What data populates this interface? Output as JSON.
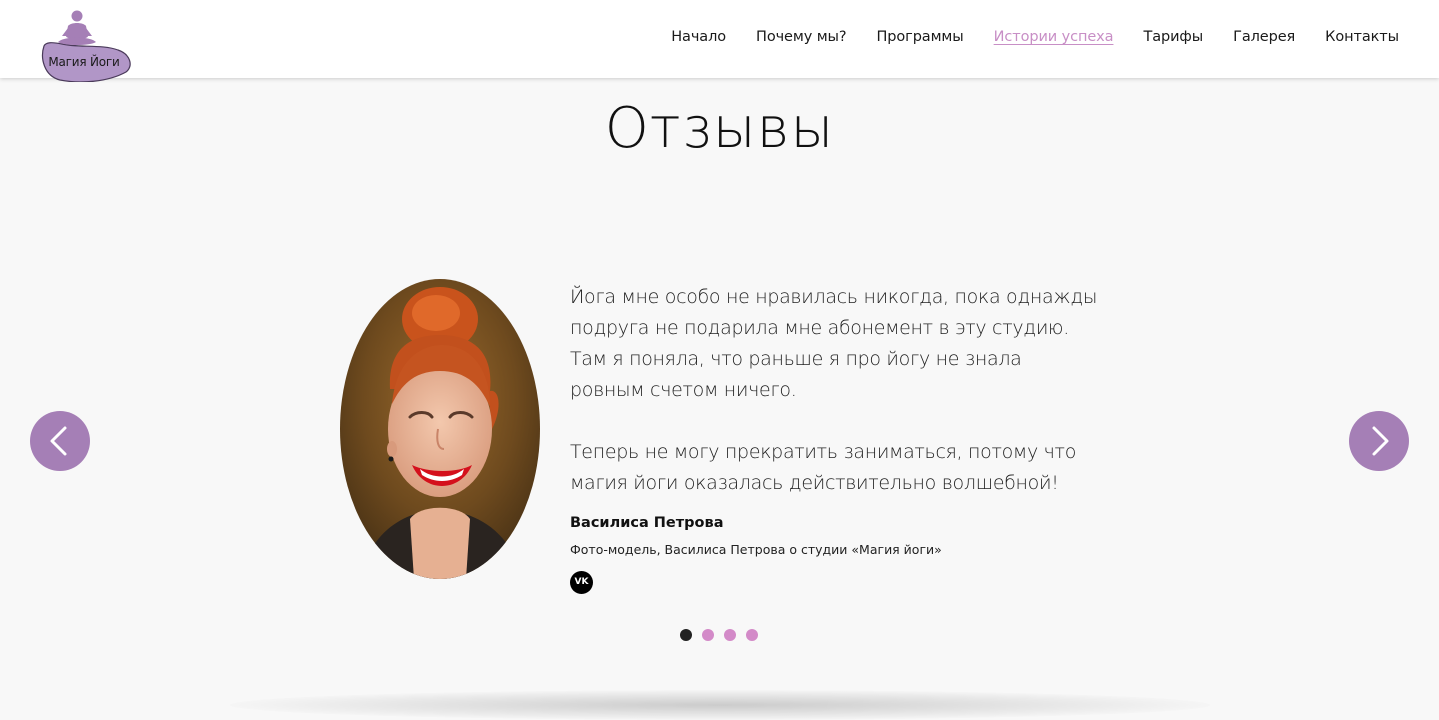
{
  "header": {
    "logo_text": "Магия Йоги",
    "nav": [
      {
        "label": "Начало",
        "active": false
      },
      {
        "label": "Почему мы?",
        "active": false
      },
      {
        "label": "Программы",
        "active": false
      },
      {
        "label": "Истории успеха",
        "active": true
      },
      {
        "label": "Тарифы",
        "active": false
      },
      {
        "label": "Галерея",
        "active": false
      },
      {
        "label": "Контакты",
        "active": false
      }
    ]
  },
  "reviews": {
    "title": "Отзывы",
    "quote_paragraph_1": "Йога мне особо не нравилась никогда, пока однажды подруга не подарила мне абонемент в эту студию. Там я поняла, что раньше я про йогу не знала ровным счетом ничего.",
    "quote_paragraph_2": "Теперь не могу прекратить заниматься, потому что магия йоги оказалась действительно волшебной!",
    "author_name": "Василиса Петрова",
    "author_role": "Фото-модель, Василиса Петрова о студии «Магия йоги»",
    "social_label": "VK",
    "dots": 4,
    "active_dot": 0
  },
  "colors": {
    "accent_purple": "#a57fb6",
    "accent_pink": "#c88fc6",
    "dot_pink": "#d38ac8",
    "page_bg": "#f8f8f8"
  },
  "icons": {
    "prev": "chevron-left-icon",
    "next": "chevron-right-icon",
    "social": "vk-icon",
    "logo": "meditating-figure-icon"
  }
}
